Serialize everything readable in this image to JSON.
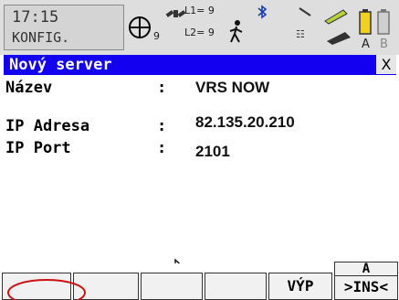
{
  "status": {
    "time": "17:15",
    "mode": "KONFIG.",
    "sat_count": "9",
    "l1_label": "L1= 9",
    "l2_label": "L2= 9",
    "battery_labels": [
      "A",
      "B"
    ]
  },
  "dialog": {
    "title": "Nový server",
    "close_label": "X",
    "fields": [
      {
        "label": "Název",
        "sep": ":",
        "value": "VRS NOW"
      },
      {
        "label": "IP Adresa",
        "sep": ":",
        "value": "82.135.20.210"
      },
      {
        "label": "IP Port",
        "sep": ":",
        "value": "2101"
      }
    ]
  },
  "softkeys": {
    "key5": "VÝP",
    "key6_top": "A",
    "key6": ">INS<"
  },
  "colors": {
    "title_bar": "#1400f0",
    "annotation_circle": "#cc1111"
  }
}
